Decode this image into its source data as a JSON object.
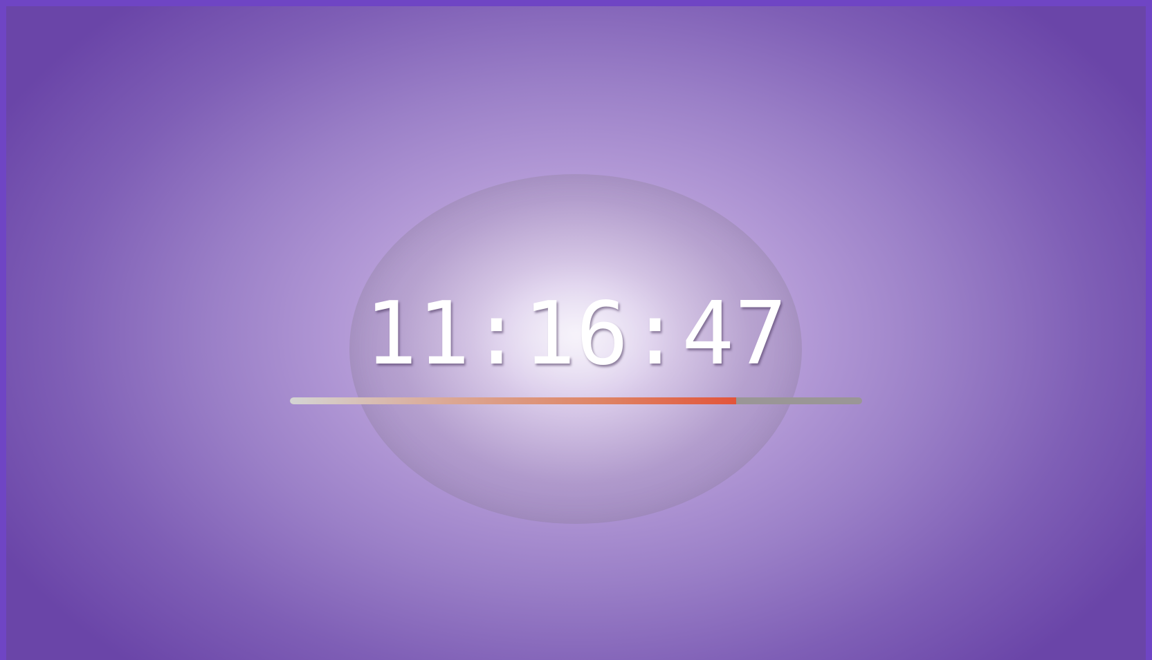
{
  "clock": {
    "time": "11:16:47"
  },
  "progress": {
    "percent": 78,
    "colors": {
      "start": "#d4d4d4",
      "end": "#e2543a",
      "track": "#9a9696"
    }
  },
  "background": {
    "colors": {
      "border": "#6f45c4",
      "center": "#ede6f6",
      "edge": "#6a45a8"
    }
  }
}
